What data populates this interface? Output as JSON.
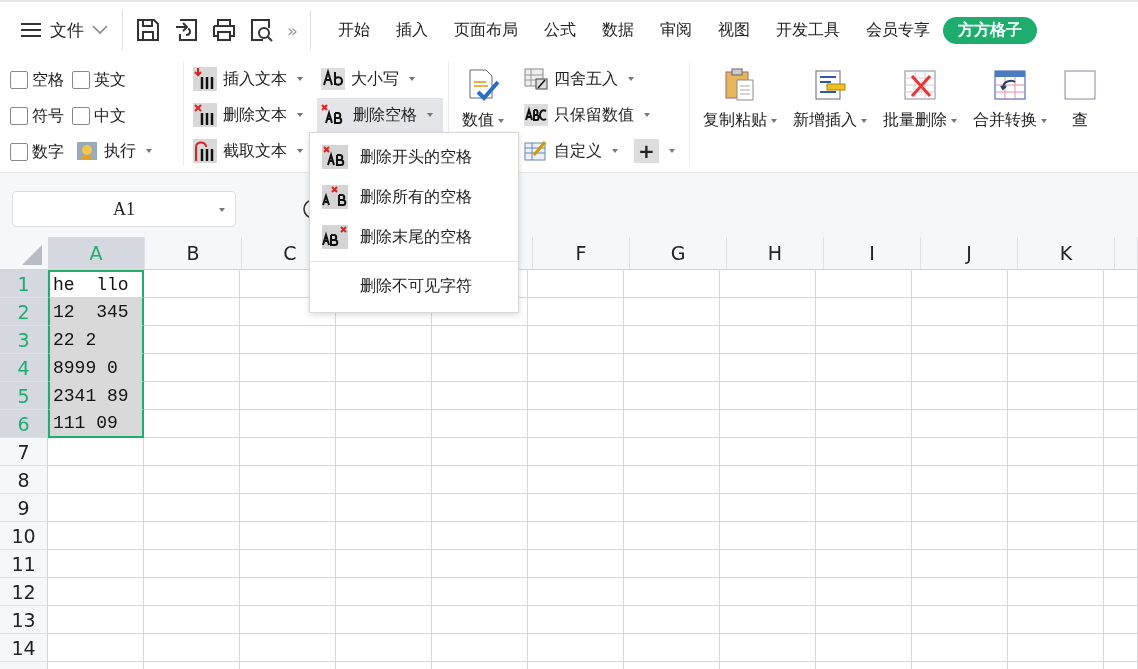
{
  "menu_bar": {
    "file": "文件",
    "more": "»",
    "tabs": [
      {
        "label": "开始",
        "selected": false
      },
      {
        "label": "插入",
        "selected": false
      },
      {
        "label": "页面布局",
        "selected": false
      },
      {
        "label": "公式",
        "selected": false
      },
      {
        "label": "数据",
        "selected": false
      },
      {
        "label": "审阅",
        "selected": false
      },
      {
        "label": "视图",
        "selected": false
      },
      {
        "label": "开发工具",
        "selected": false
      },
      {
        "label": "会员专享",
        "selected": false
      },
      {
        "label": "方方格子",
        "selected": true
      }
    ]
  },
  "ribbon": {
    "checkboxes": [
      {
        "label": "空格",
        "checked": false
      },
      {
        "label": "英文",
        "checked": false
      },
      {
        "label": "符号",
        "checked": false
      },
      {
        "label": "中文",
        "checked": false
      },
      {
        "label": "数字",
        "checked": false
      }
    ],
    "run": "执行",
    "text_tools": [
      {
        "label": "插入文本",
        "kind": "insert"
      },
      {
        "label": "删除文本",
        "kind": "delete"
      },
      {
        "label": "截取文本",
        "kind": "extract"
      }
    ],
    "case": "大小写",
    "remove_spaces": {
      "label": "删除空格",
      "open": true,
      "menu": [
        {
          "label": "删除开头的空格",
          "kind": "leading"
        },
        {
          "label": "删除所有的空格",
          "kind": "all"
        },
        {
          "label": "删除末尾的空格",
          "kind": "trailing"
        },
        {
          "label": "删除不可见字符",
          "kind": "invisible"
        }
      ]
    },
    "value": "数值",
    "number_tools": [
      {
        "label": "四舍五入",
        "kind": "round"
      },
      {
        "label": "只保留数值",
        "kind": "keep"
      },
      {
        "label": "自定义",
        "kind": "custom"
      }
    ],
    "plus": "+",
    "big_buttons": [
      {
        "label": "复制粘贴",
        "kind": "paste"
      },
      {
        "label": "新增插入",
        "kind": "insert"
      },
      {
        "label": "批量删除",
        "kind": "delete"
      },
      {
        "label": "合并转换",
        "kind": "merge"
      },
      {
        "label": "查",
        "kind": "find"
      }
    ]
  },
  "name_box": "A1",
  "sheet": {
    "columns": [
      {
        "label": "A",
        "selected": true
      },
      {
        "label": "B",
        "selected": false
      },
      {
        "label": "C",
        "selected": false
      },
      {},
      {},
      {
        "label": "F",
        "selected": false
      },
      {
        "label": "G",
        "selected": false
      },
      {
        "label": "H",
        "selected": false
      },
      {
        "label": "I",
        "selected": false
      },
      {
        "label": "J",
        "selected": false
      },
      {
        "label": "K",
        "selected": false
      }
    ],
    "rows": [
      {
        "number": "1",
        "selected": true,
        "active": true,
        "value": "he  llo"
      },
      {
        "number": "2",
        "selected": true,
        "value": "12  345"
      },
      {
        "number": "3",
        "selected": true,
        "value": "22 2"
      },
      {
        "number": "4",
        "selected": true,
        "value": "8999 0"
      },
      {
        "number": "5",
        "selected": true,
        "value": "2341 89"
      },
      {
        "number": "6",
        "selected": true,
        "value": "111 09"
      },
      {
        "number": "7",
        "selected": false
      },
      {
        "number": "8",
        "selected": false
      },
      {
        "number": "9",
        "selected": false
      },
      {
        "number": "10",
        "selected": false
      },
      {
        "number": "11",
        "selected": false
      },
      {
        "number": "12",
        "selected": false
      },
      {
        "number": "13",
        "selected": false
      },
      {
        "number": "14",
        "selected": false
      }
    ]
  }
}
